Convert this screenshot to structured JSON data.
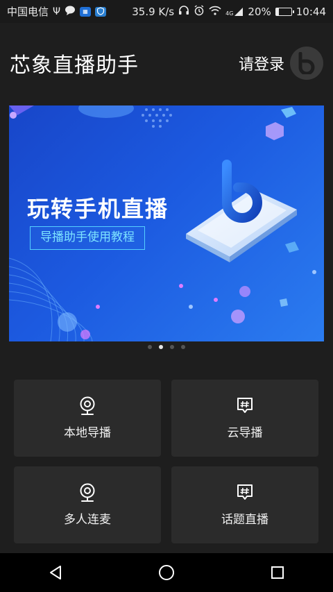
{
  "status_bar": {
    "carrier": "中国电信",
    "net_speed": "35.9 K/s",
    "network_type": "4G",
    "battery": "20%",
    "battery_level": 0.2,
    "time": "10:44",
    "icons": [
      "usb-icon",
      "chat-icon",
      "app-notification-icon",
      "shield-icon",
      "headphones-icon",
      "alarm-icon",
      "wifi-icon",
      "signal-icon",
      "battery-icon"
    ]
  },
  "header": {
    "title": "芯象直播助手",
    "login": "请登录"
  },
  "banner": {
    "headline": "玩转手机直播",
    "subtitle": "导播助手使用教程",
    "page_count": 4,
    "active_index": 1
  },
  "tiles": [
    {
      "label": "本地导播",
      "icon": "camera-icon"
    },
    {
      "label": "云导播",
      "icon": "hashtag-chat-icon"
    },
    {
      "label": "多人连麦",
      "icon": "camera-icon"
    },
    {
      "label": "话题直播",
      "icon": "hashtag-chat-icon"
    }
  ],
  "colors": {
    "background": "#1e1e1e",
    "tile": "#2b2b2b",
    "banner_blue": "#1c5ae0",
    "banner_accent": "#55d0ff"
  },
  "nav": [
    "back-icon",
    "home-icon",
    "recents-icon"
  ]
}
